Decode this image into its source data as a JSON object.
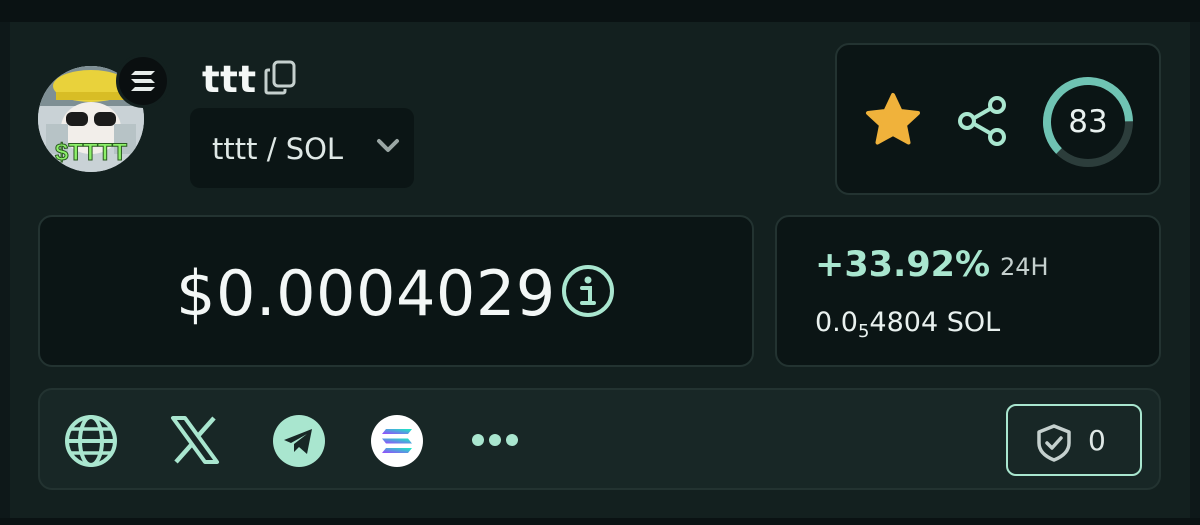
{
  "token": {
    "name": "ttt",
    "pair": "tttt / SOL",
    "avatar_text": "$TTTT",
    "chain_icon": "solana-icon"
  },
  "score": {
    "value": "83",
    "fraction": 0.83
  },
  "price": {
    "usd": "$0.0004029"
  },
  "change": {
    "percent": "+33.92%",
    "period": "24H",
    "sol_prefix": "0.0",
    "sol_zeros": "5",
    "sol_digits": "4804",
    "sol_unit": " SOL"
  },
  "links": {
    "icons": [
      "globe-icon",
      "x-icon",
      "telegram-icon",
      "solana-icon",
      "more-icon"
    ]
  },
  "audit": {
    "count": "0"
  },
  "colors": {
    "accent": "#a9e6cf",
    "star": "#f0b23b",
    "background": "#13201f",
    "card": "#0b1515"
  }
}
